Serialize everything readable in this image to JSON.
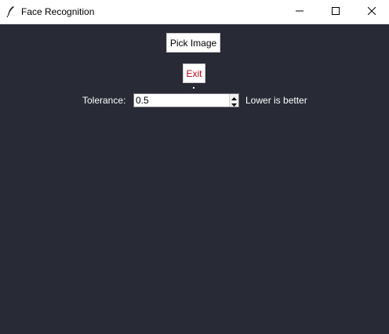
{
  "window": {
    "title": "Face Recognition",
    "icons": {
      "app": "feather-icon",
      "minimize": "minimize-icon",
      "maximize": "maximize-icon",
      "close": "close-icon"
    }
  },
  "main": {
    "pick_image_label": "Pick Image",
    "exit_label": "Exit",
    "tolerance_label": "Tolerance:",
    "tolerance_value": "0.5",
    "tolerance_hint": "Lower is better"
  },
  "colors": {
    "background": "#282a36",
    "exit_text": "#c0001a"
  }
}
